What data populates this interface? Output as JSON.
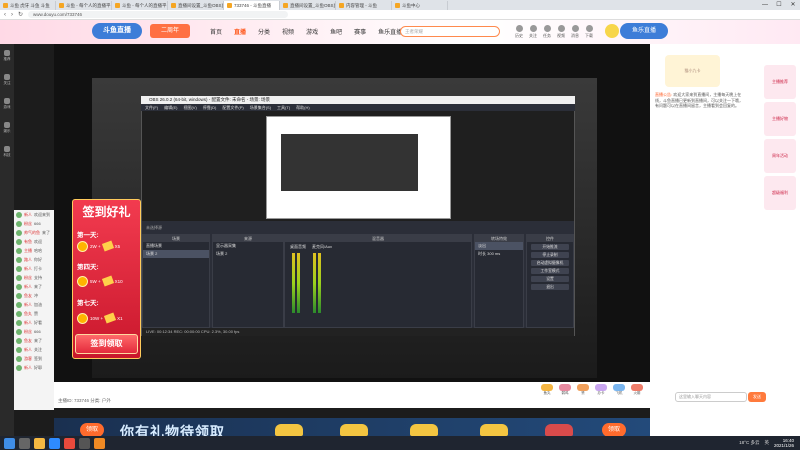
{
  "browser": {
    "tabs": [
      {
        "label": "斗鱼 虎牙 斗鱼 斗鱼"
      },
      {
        "label": "斗鱼 - 每个人的直播平台"
      },
      {
        "label": "斗鱼 - 每个人的直播平台"
      },
      {
        "label": "直播间设置_斗鱼OBS直播"
      },
      {
        "label": "733746 - 斗鱼直播"
      },
      {
        "label": "直播间设置_斗鱼OBS直播"
      },
      {
        "label": "内容管理 - 斗鱼"
      },
      {
        "label": "斗鱼中心"
      }
    ],
    "active_tab": 4,
    "url": "www.douyu.com/733746",
    "window_buttons": [
      "—",
      "☐",
      "✕"
    ],
    "nav_glyphs": [
      "‹",
      "›",
      "↻"
    ]
  },
  "douyu_header": {
    "logo": "斗鱼直播",
    "logo_sub": "二周年",
    "nav": [
      "首页",
      "直播",
      "分类",
      "视频",
      "游戏",
      "鱼吧",
      "赛事",
      "鱼乐直播"
    ],
    "nav_active": 1,
    "search_placeholder": "王者荣耀",
    "icons": [
      "历史",
      "关注",
      "任务",
      "视频",
      "消息",
      "下载"
    ],
    "banner": "鱼乐直播"
  },
  "left_sidebar": [
    "推荐",
    "关注",
    "游戏",
    "娱乐",
    "科技"
  ],
  "obs": {
    "title": "OBS 26.0.2 (64-bit, windows) - 配置文件: 未命名 - 场景: 场景",
    "menu": [
      "文件(F)",
      "编辑(E)",
      "视图(V)",
      "停靠(D)",
      "配置文件(P)",
      "场景集合(S)",
      "工具(T)",
      "帮助(H)"
    ],
    "scene_label": "未选择源",
    "docks": {
      "scenes": {
        "title": "场景",
        "items": [
          "直播场景",
          "场景 2"
        ],
        "selected": 1
      },
      "sources": {
        "title": "来源",
        "items": [
          "显示器采集",
          "场景 2"
        ]
      },
      "mixer": {
        "title": "混音器",
        "channels": [
          "桌面音频",
          "麦克风/Aux"
        ]
      },
      "transitions": {
        "title": "转场特效",
        "type": "淡出",
        "duration_label": "时长",
        "duration": "300 ms"
      },
      "controls": {
        "title": "控件",
        "buttons": [
          "开始推流",
          "停止录制",
          "启动虚拟摄像机",
          "工作室模式",
          "设置",
          "退出"
        ]
      }
    },
    "status": "LIVE: 00:12:34   REC: 00:00:00   CPU: 2.3%, 30.00 fps"
  },
  "promo": {
    "title": "签到好礼",
    "days": [
      {
        "label": "第一天:",
        "reward": "2W +",
        "count": "X5"
      },
      {
        "label": "第四天:",
        "reward": "5W +",
        "count": "X10"
      },
      {
        "label": "第七天:",
        "reward": "10W +",
        "count": "X1"
      }
    ],
    "button": "签到领取"
  },
  "chat_rows": [
    {
      "user": "新人",
      "text": "欢迎来到"
    },
    {
      "user": "粉丝",
      "text": "666"
    },
    {
      "user": "帅气的鱼",
      "text": "来了"
    },
    {
      "user": "有鱼",
      "text": "欢迎"
    },
    {
      "user": "主播",
      "text": "哈哈"
    },
    {
      "user": "路人",
      "text": "你好"
    },
    {
      "user": "新人",
      "text": "打卡"
    },
    {
      "user": "粉丝",
      "text": "支持"
    },
    {
      "user": "新人",
      "text": "来了"
    },
    {
      "user": "鱼友",
      "text": "冲"
    },
    {
      "user": "新人",
      "text": "加油"
    },
    {
      "user": "鱼丸",
      "text": "赞"
    },
    {
      "user": "新人",
      "text": "好看"
    },
    {
      "user": "粉丝",
      "text": "666"
    },
    {
      "user": "鱼友",
      "text": "来了"
    },
    {
      "user": "新人",
      "text": "关注"
    },
    {
      "user": "游客",
      "text": "签到"
    },
    {
      "user": "新人",
      "text": "好耶"
    }
  ],
  "info_bar": {
    "text": "主播ID: 733746  分类: 户外",
    "gifts": [
      {
        "label": "鱼丸",
        "color": "#f5b642"
      },
      {
        "label": "弱鸡",
        "color": "#e88aa0"
      },
      {
        "label": "赞",
        "color": "#f0a05c"
      },
      {
        "label": "办卡",
        "color": "#c9a6f0"
      },
      {
        "label": "飞机",
        "color": "#7ab6f0"
      },
      {
        "label": "火箭",
        "color": "#ef7d6a"
      }
    ]
  },
  "right_panel": {
    "avatar_label": "猫小九卡",
    "notice_title": "直播公告:",
    "notice_body": "欢迎大家来到直播间，主播每天晚上在线，斗鱼直播已更新到直播间，可以关注一下哦，有问题可以在直播间留言，主播看到会回复的。",
    "ads": [
      "主播推荐",
      "主播好物",
      "周年活动",
      "超级福利"
    ],
    "chat_placeholder": "这里输入聊天内容",
    "send": "发送"
  },
  "bottom_ad": {
    "text": "你有礼物待领取",
    "left_button": "领取",
    "right_button": "领取"
  },
  "taskbar": {
    "weather": "18°C 多云",
    "lang": "英",
    "time": "16:40",
    "date": "2021/1/26"
  }
}
